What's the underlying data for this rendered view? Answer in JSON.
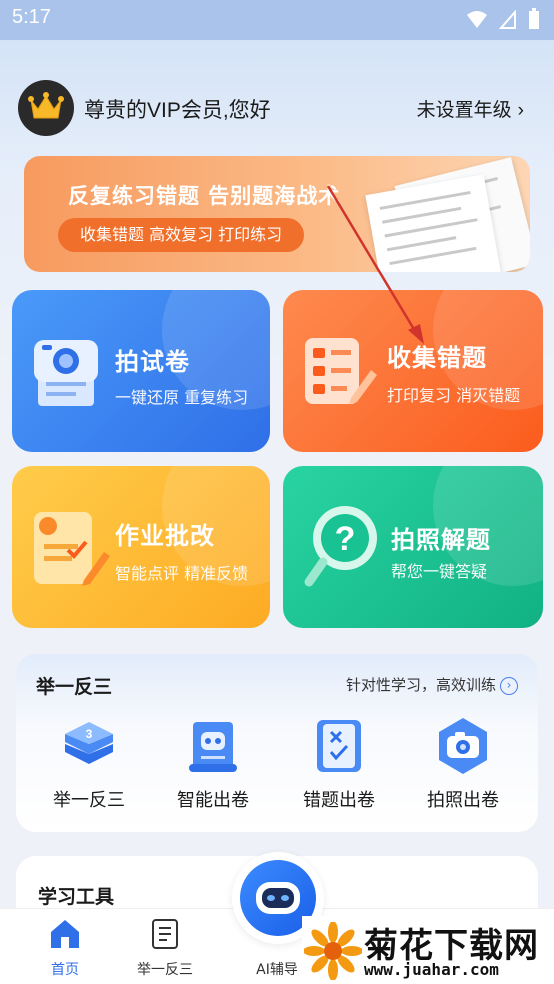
{
  "status": {
    "time": "5:17"
  },
  "header": {
    "greeting": "尊贵的VIP会员,您好",
    "grade_link": "未设置年级",
    "grade_chevron": "›"
  },
  "banner": {
    "title": "反复练习错题 告别题海战术",
    "tag": "收集错题 高效复习 打印练习"
  },
  "cards": [
    {
      "title": "拍试卷",
      "subtitle": "一键还原 重复练习"
    },
    {
      "title": "收集错题",
      "subtitle": "打印复习 消灭错题"
    },
    {
      "title": "作业批改",
      "subtitle": "智能点评 精准反馈"
    },
    {
      "title": "拍照解题",
      "subtitle": "帮您一键答疑"
    }
  ],
  "practice": {
    "title": "举一反三",
    "link": "针对性学习，高效训练",
    "items": [
      {
        "label": "举一反三"
      },
      {
        "label": "智能出卷"
      },
      {
        "label": "错题出卷"
      },
      {
        "label": "拍照出卷"
      }
    ]
  },
  "tools": {
    "title": "学习工具"
  },
  "tabbar": {
    "home": "首页",
    "practice": "举一反三",
    "ai": "AI辅导"
  },
  "watermark": {
    "main": "菊花下载网",
    "url": "www.juahar.com"
  },
  "colors": {
    "primary": "#2f6fe8",
    "orange": "#fb5c1d",
    "yellow": "#fdab23",
    "green": "#11b184"
  }
}
